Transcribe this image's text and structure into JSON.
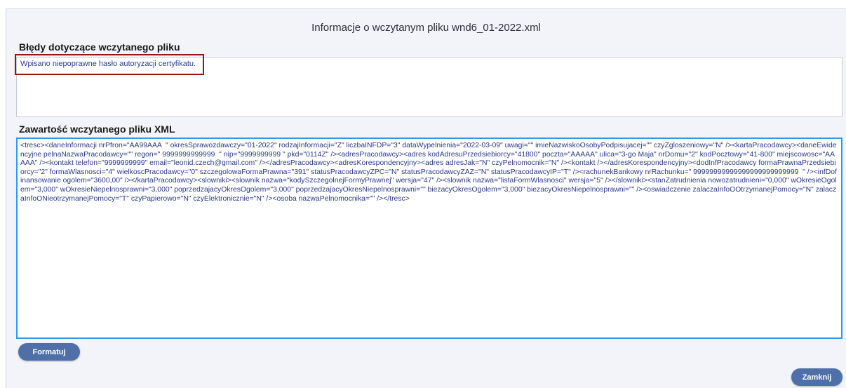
{
  "dialog": {
    "title": "Informacje o wczytanym pliku wnd6_01-2022.xml"
  },
  "errors": {
    "label": "Błędy dotyczące wczytanego pliku",
    "message": "Wpisano niepoprawne hasło autoryzacji certyfikatu."
  },
  "xml": {
    "label": "Zawartość wczytanego pliku XML",
    "content": "<tresc><daneInformacji nrPfron=\"AA99AAA  \" okresSprawozdawczy=\"01-2022\" rodzajInformacji=\"Z\" liczbaINFDP=\"3\" dataWypelnienia=\"2022-03-09\" uwagi=\"\" imieNazwiskoOsobyPodpisujacej=\"\" czyZgloszeniowy=\"N\" /><kartaPracodawcy><daneEwidencyjne pelnaNazwaPracodawcy=\"\" regon=\" 9999999999999  \" nip=\"9999999999 \" pkd=\"0114Z\" /><adresPracodawcy><adres kodAdresuPrzedsiebiorcy=\"41800\" poczta=\"AAAAA\" ulica=\"3-go Maja\" nrDomu=\"2\" kodPocztowy=\"41-800\" miejscowosc=\"AAAAA\" /><kontakt telefon=\"9999999999\" email=\"leonid.czech@gmail.com\" /></adresPracodawcy><adresKorespondencyjny><adres adresJak=\"N\" czyPelnomocnik=\"N\" /><kontakt /></adresKorespondencyjny><dodInfPracodawcy formaPrawnaPrzedsiebiorcy=\"2\" formaWlasnosci=\"4\" wielkoscPracodawcy=\"0\" szczegolowaFormaPrawna=\"391\" statusPracodawcyZPC=\"N\" statusPracodawcyZAZ=\"N\" statusPracodawcyIP=\"T\" /><rachunekBankowy nrRachunku=\" 99999999999999999999999999  \" /><infDofinansowanie ogolem=\"3600,00\" /></kartaPracodawcy><slowniki><slownik nazwa=\"kodySzczegolnejFormyPrawnej\" wersja=\"47\" /><slownik nazwa=\"listaFormWlasnosci\" wersja=\"5\" /></slowniki><stanZatrudnienia nowozatrudnieni=\"0,000\" wOkresieOgolem=\"3,000\" wOkresieNiepelnosprawni=\"3,000\" poprzedzajacyOkresOgolem=\"3,000\" poprzedzajacyOkresNiepelnosprawni=\"\" biezacyOkresOgolem=\"3,000\" biezacyOkresNiepelnosprawni=\"\" /><oswiadczenie zalaczaInfoOOtrzymanejPomocy=\"N\" zalaczaInfoONieotrzymanejPomocy=\"T\" czyPapierowo=\"N\" czyElektronicznie=\"N\" /><osoba nazwaPelnomocnika=\"\" /></tresc>"
  },
  "buttons": {
    "format_label": "Formatuj",
    "close_label": "Zamknij"
  },
  "colors": {
    "button": "#4f6fa8",
    "xml_border": "#2f98e8",
    "error_highlight": "#8b1a1a",
    "panel_bg": "#f2f4f9"
  }
}
